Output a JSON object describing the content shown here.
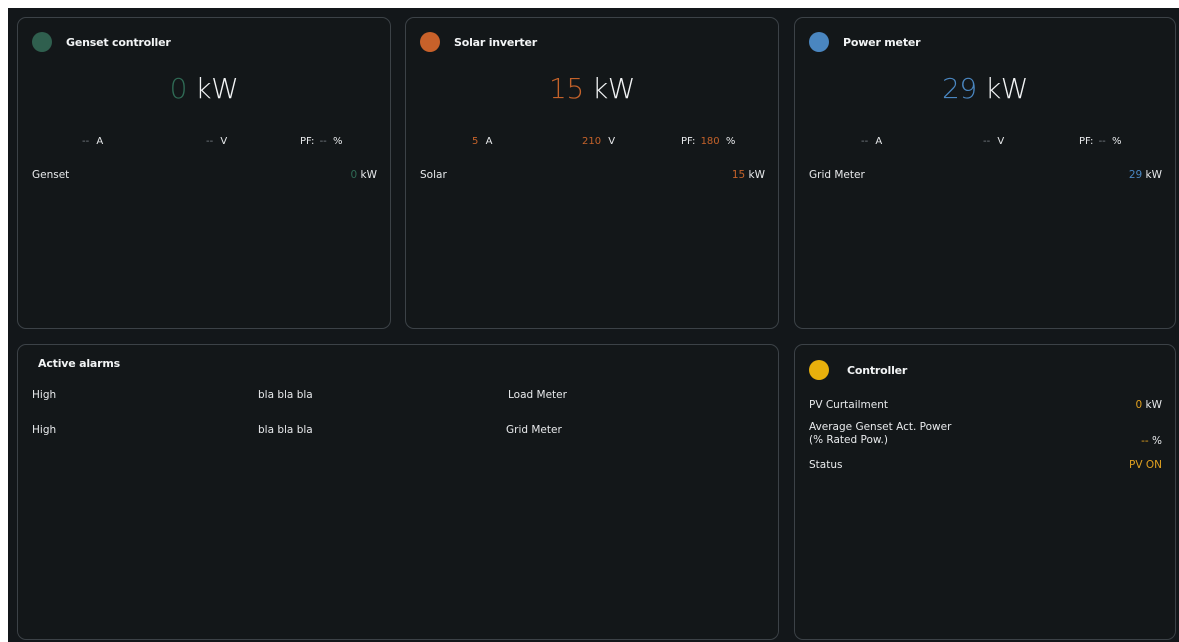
{
  "cards": {
    "genset": {
      "title": "Genset controller",
      "color": "#2f5f4e",
      "power_value": "0",
      "power_unit": "kW",
      "current": "--",
      "current_unit": "A",
      "voltage": "--",
      "voltage_unit": "V",
      "pf_label": "PF:",
      "pf_value": "--",
      "pf_unit": "%",
      "row_label": "Genset",
      "row_value": "0",
      "row_unit": "kW"
    },
    "solar": {
      "title": "Solar inverter",
      "color": "#c8612a",
      "power_value": "15",
      "power_unit": "kW",
      "current": "5",
      "current_unit": "A",
      "voltage": "210",
      "voltage_unit": "V",
      "pf_label": "PF:",
      "pf_value": "180",
      "pf_unit": "%",
      "row_label": "Solar",
      "row_value": "15",
      "row_unit": "kW"
    },
    "meter": {
      "title": "Power meter",
      "color": "#4a86c0",
      "power_value": "29",
      "power_unit": "kW",
      "current": "--",
      "current_unit": "A",
      "voltage": "--",
      "voltage_unit": "V",
      "pf_label": "PF:",
      "pf_value": "--",
      "pf_unit": "%",
      "row_label": "Grid Meter",
      "row_value": "29",
      "row_unit": "kW"
    }
  },
  "alarms": {
    "title": "Active alarms",
    "rows": [
      {
        "severity": "High",
        "message": "bla bla bla",
        "source": "Load Meter"
      },
      {
        "severity": "High",
        "message": "bla bla bla",
        "source": "Grid Meter"
      }
    ]
  },
  "controller": {
    "title": "Controller",
    "color": "#e8b00c",
    "pv_curtailment_label": "PV Curtailment",
    "pv_curtailment_value": "0",
    "pv_curtailment_unit": "kW",
    "avg_genset_label_1": "Average Genset Act. Power",
    "avg_genset_label_2": "(% Rated Pow.)",
    "avg_genset_value": "--",
    "avg_genset_unit": "%",
    "status_label": "Status",
    "status_value": "PV ON"
  }
}
